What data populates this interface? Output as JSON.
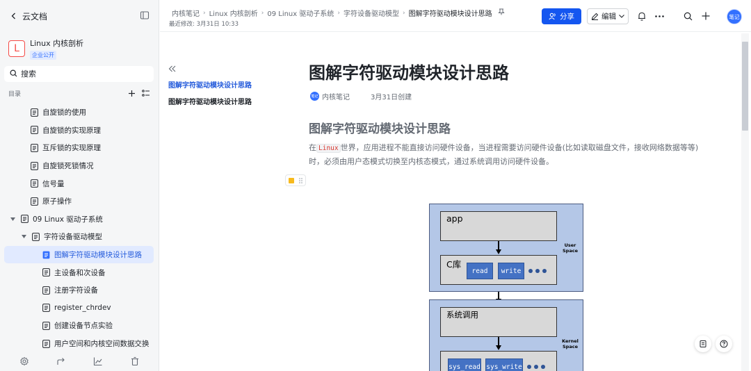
{
  "sidebar": {
    "back_label": "云文档",
    "kb_logo": "L",
    "kb_name": "Linux 内核剖析",
    "kb_badge": "企业公开",
    "search_placeholder": "搜索",
    "toc_label": "目录",
    "items": [
      {
        "label": "自旋锁的使用"
      },
      {
        "label": "自旋锁的实现原理"
      },
      {
        "label": "互斥锁的实现原理"
      },
      {
        "label": "自旋锁死锁情况"
      },
      {
        "label": "信号量"
      },
      {
        "label": "原子操作"
      },
      {
        "label": "09 Linux 驱动子系统"
      },
      {
        "label": "字符设备驱动模型"
      },
      {
        "label": "图解字符驱动模块设计思路"
      },
      {
        "label": "主设备和次设备"
      },
      {
        "label": "注册字符设备"
      },
      {
        "label": "register_chrdev"
      },
      {
        "label": "创建设备节点实验"
      },
      {
        "label": "用户空间和内核空间数据交换"
      }
    ]
  },
  "header": {
    "breadcrumbs": [
      "内核笔记",
      "Linux 内核剖析",
      "09 Linux 驱动子系统",
      "字符设备驱动模型",
      "图解字符驱动模块设计思路"
    ],
    "last_modified": "最近修改: 3月31日 10:33",
    "share_label": "分享",
    "edit_label": "编辑",
    "avatar_text": "笔记"
  },
  "outline": {
    "items": [
      "图解字符驱动模块设计思路",
      "图解字符驱动模块设计思路"
    ]
  },
  "doc": {
    "title": "图解字符驱动模块设计思路",
    "author_avatar": "笔记",
    "author": "内核笔记",
    "created": "3月31日创建",
    "heading": "图解字符驱动模块设计思路",
    "para_before": "在",
    "para_code": "Linux",
    "para_after": "世界，应用进程不能直接访问硬件设备，当进程需要访问硬件设备(比如读取磁盘文件，接收网络数据等等)时，必须由用户态模式切换至内核态模式，通过系统调用访问硬件设备。"
  },
  "diagram": {
    "app_label": "app",
    "clib_label": "C库",
    "read_label": "read",
    "write_label": "write",
    "user_space_line1": "User",
    "user_space_line2": "Space",
    "syscall_label": "系统调用",
    "sys_read_label": "sys_read",
    "sys_write_label": "sys_write",
    "kernel_space_line1": "Kernel",
    "kernel_space_line2": "Space"
  },
  "colors": {
    "accent": "#1456f0",
    "diagram_layer": "#b4c7e7",
    "diagram_chip": "#4472c4",
    "code_text": "#d83931"
  }
}
